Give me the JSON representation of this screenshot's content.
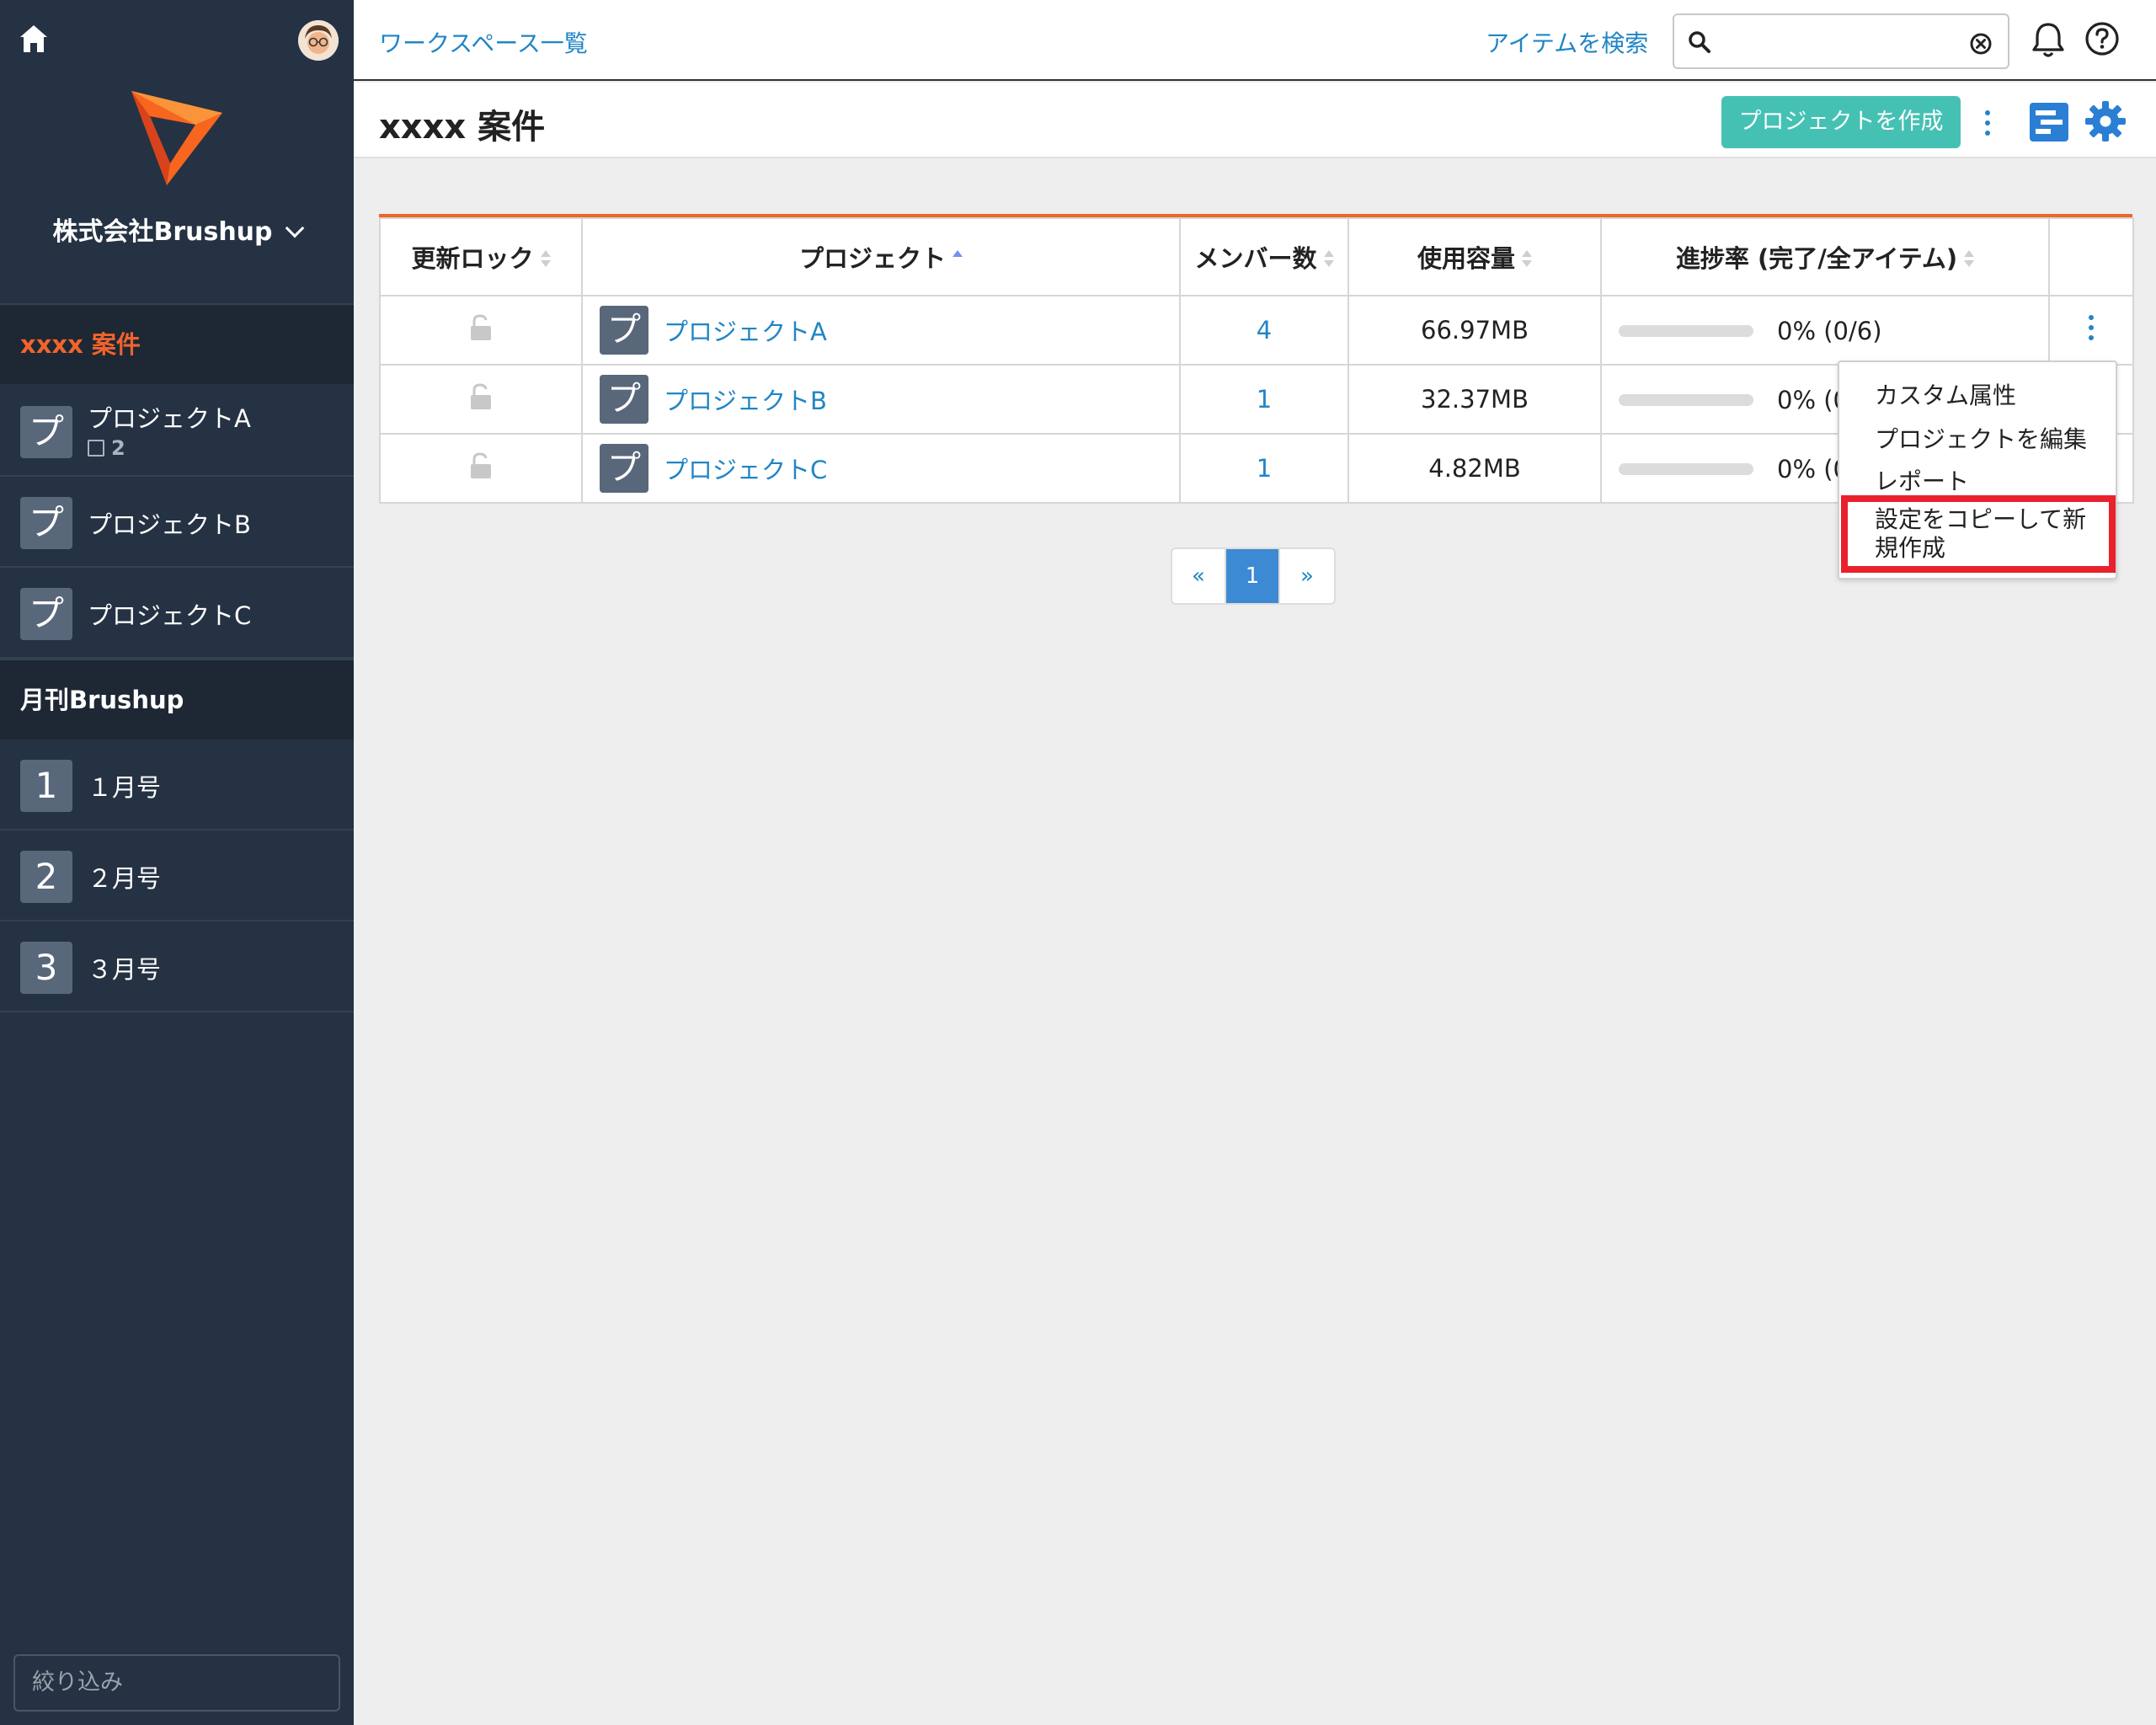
{
  "sidebar": {
    "org_name": "株式会社Brushup",
    "sections": [
      {
        "label": "xxxx 案件",
        "items": [
          {
            "badge": "プ",
            "label": "プロジェクトA",
            "sub_count": "2"
          },
          {
            "badge": "プ",
            "label": "プロジェクトB"
          },
          {
            "badge": "プ",
            "label": "プロジェクトC"
          }
        ]
      },
      {
        "label": "月刊Brushup",
        "items": [
          {
            "badge": "1",
            "label": "１月号"
          },
          {
            "badge": "2",
            "label": "２月号"
          },
          {
            "badge": "3",
            "label": "３月号"
          }
        ]
      }
    ],
    "filter_placeholder": "絞り込み"
  },
  "topbar": {
    "workspace_link": "ワークスペース一覧",
    "search_link": "アイテムを検索",
    "search_value": ""
  },
  "header": {
    "title": "xxxx 案件",
    "create_button": "プロジェクトを作成"
  },
  "table": {
    "columns": [
      "更新ロック",
      "プロジェクト",
      "メンバー数",
      "使用容量",
      "進捗率 (完了/全アイテム)"
    ],
    "rows": [
      {
        "badge": "プ",
        "name": "プロジェクトA",
        "members": "4",
        "usage": "66.97MB",
        "progress_pct": 0,
        "progress": "0% (0/6)"
      },
      {
        "badge": "プ",
        "name": "プロジェクトB",
        "members": "1",
        "usage": "32.37MB",
        "progress_pct": 0,
        "progress": "0% (0"
      },
      {
        "badge": "プ",
        "name": "プロジェクトC",
        "members": "1",
        "usage": "4.82MB",
        "progress_pct": 0,
        "progress": "0% (0"
      }
    ]
  },
  "menu": {
    "items": [
      "カスタム属性",
      "プロジェクトを編集",
      "レポート",
      "設定をコピーして新",
      "規作成"
    ]
  },
  "pagination": {
    "prev": "«",
    "current": "1",
    "next": "»"
  },
  "colors": {
    "accent": "#f0642d",
    "primary": "#45c1b4",
    "link": "#2185c5",
    "sidebar": "#253243",
    "highlight": "#e8212c"
  }
}
